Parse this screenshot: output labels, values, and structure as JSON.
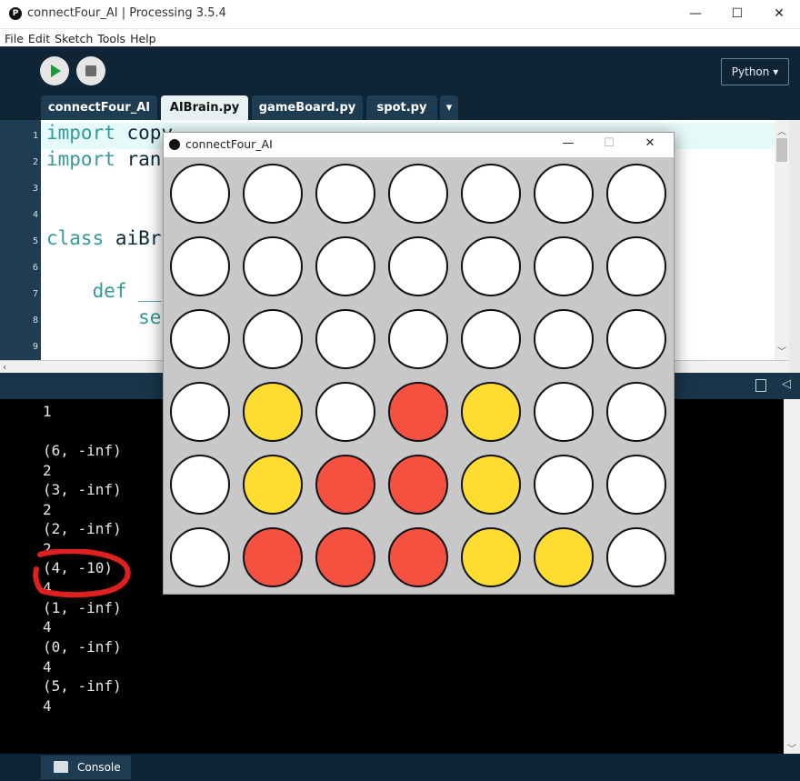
{
  "window": {
    "title": "connectFour_AI | Processing 3.5.4",
    "buttons": [
      "—",
      "☐",
      "✕"
    ]
  },
  "menu": [
    "File",
    "Edit",
    "Sketch",
    "Tools",
    "Help"
  ],
  "toolbar": {
    "mode": "Python ▾"
  },
  "tabs": [
    {
      "label": "connectFour_AI",
      "active": false
    },
    {
      "label": "AIBrain.py",
      "active": true
    },
    {
      "label": "gameBoard.py",
      "active": false
    },
    {
      "label": "spot.py",
      "active": false
    }
  ],
  "tabs_more": "▾",
  "editor": {
    "lines": [
      {
        "n": "1",
        "kw": "import",
        "rest": " copy"
      },
      {
        "n": "2",
        "kw": "import",
        "rest": " ran"
      },
      {
        "n": "3",
        "kw": "",
        "rest": ""
      },
      {
        "n": "4",
        "kw": "",
        "rest": ""
      },
      {
        "n": "5",
        "kw": "class",
        "rest": " aiBr"
      },
      {
        "n": "6",
        "kw": "",
        "rest": ""
      },
      {
        "n": "7",
        "kw": "    def",
        "rest": " __"
      },
      {
        "n": "8",
        "kw": "",
        "rest": "        se"
      },
      {
        "n": "9",
        "kw": "",
        "rest": ""
      }
    ]
  },
  "console": {
    "lines": [
      "1",
      "",
      "(6, -inf)",
      "2",
      "(3, -inf)",
      "2",
      "(2, -inf)",
      "2",
      "(4, -10)",
      "4",
      "(1, -inf)",
      "4",
      "(0, -inf)",
      "4",
      "(5, -inf)",
      "4"
    ],
    "tab_label": "Console"
  },
  "sketch_window": {
    "title": "connectFour_AI",
    "buttons": [
      "—",
      "☐",
      "✕"
    ]
  },
  "board": {
    "colors": {
      "empty": "#ffffff",
      "red": "#f55040",
      "yellow": "#ffdc30",
      "background": "#c8c8c8"
    },
    "rows": [
      [
        "empty",
        "empty",
        "empty",
        "empty",
        "empty",
        "empty",
        "empty"
      ],
      [
        "empty",
        "empty",
        "empty",
        "empty",
        "empty",
        "empty",
        "empty"
      ],
      [
        "empty",
        "empty",
        "empty",
        "empty",
        "empty",
        "empty",
        "empty"
      ],
      [
        "empty",
        "yellow",
        "empty",
        "red",
        "yellow",
        "empty",
        "empty"
      ],
      [
        "empty",
        "yellow",
        "red",
        "red",
        "yellow",
        "empty",
        "empty"
      ],
      [
        "empty",
        "red",
        "red",
        "red",
        "yellow",
        "yellow",
        "empty"
      ]
    ]
  },
  "annotation": {
    "color": "#e0201e"
  }
}
